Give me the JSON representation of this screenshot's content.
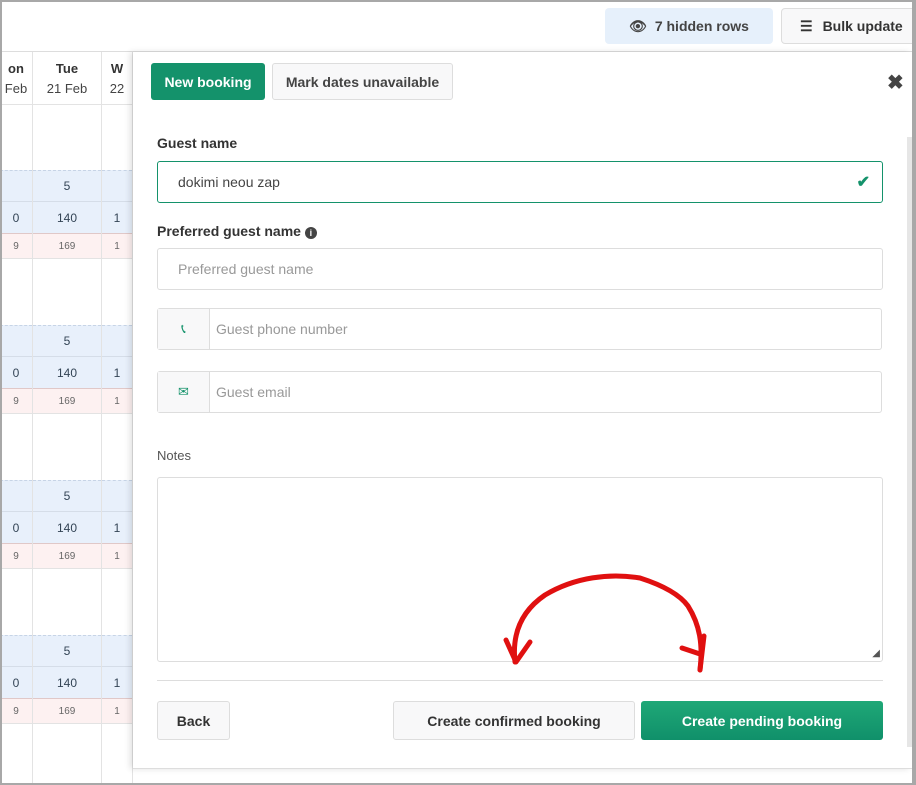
{
  "toolbar": {
    "hidden_rows": "7 hidden rows",
    "bulk_update": "Bulk update"
  },
  "calendar": {
    "columns": [
      {
        "day": "on",
        "date": "Feb"
      },
      {
        "day": "Tue",
        "date": "21 Feb"
      },
      {
        "day": "W",
        "date": "22"
      }
    ],
    "blocks": [
      {
        "units": [
          "",
          "5",
          ""
        ],
        "price": [
          "0",
          "140",
          "1"
        ],
        "rate": [
          "9",
          "169",
          "1"
        ]
      },
      {
        "units": [
          "",
          "5",
          ""
        ],
        "price": [
          "0",
          "140",
          "1"
        ],
        "rate": [
          "9",
          "169",
          "1"
        ]
      },
      {
        "units": [
          "",
          "5",
          ""
        ],
        "price": [
          "0",
          "140",
          "1"
        ],
        "rate": [
          "9",
          "169",
          "1"
        ]
      },
      {
        "units": [
          "",
          "5",
          ""
        ],
        "price": [
          "0",
          "140",
          "1"
        ],
        "rate": [
          "9",
          "169",
          "1"
        ]
      }
    ]
  },
  "panel": {
    "tabs": {
      "new_booking": "New booking",
      "mark_unavailable": "Mark dates unavailable"
    },
    "guest_name": {
      "label": "Guest name",
      "value": "dokimi neou zap"
    },
    "preferred": {
      "label": "Preferred guest name",
      "placeholder": "Preferred guest name"
    },
    "phone": {
      "placeholder": "Guest phone number"
    },
    "email": {
      "placeholder": "Guest email"
    },
    "notes": {
      "label": "Notes",
      "value": ""
    },
    "buttons": {
      "back": "Back",
      "confirmed": "Create confirmed booking",
      "pending": "Create pending booking"
    }
  },
  "colors": {
    "accent": "#14926b",
    "annotation": "#e01010"
  }
}
